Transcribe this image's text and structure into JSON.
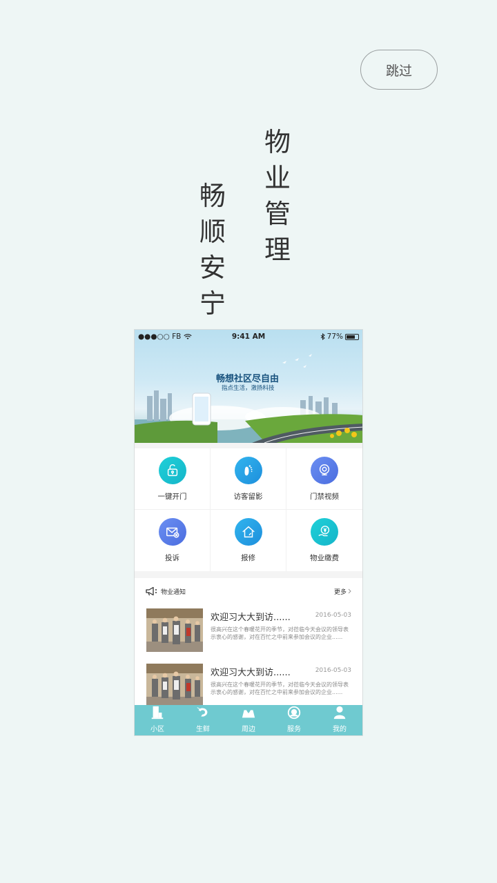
{
  "skip_button": "跳过",
  "slogan_right": [
    "物",
    "业",
    "管",
    "理"
  ],
  "slogan_left": [
    "畅",
    "顺",
    "安",
    "宁"
  ],
  "phone": {
    "status": {
      "carrier": "●●●○○ FB",
      "time": "9:41 AM",
      "battery": "77%",
      "battery_level": 0.77
    },
    "banner": {
      "title": "畅想社区尽自由",
      "subtitle": "指点生活，激扬科技"
    },
    "grid": [
      {
        "label": "一键开门",
        "icon": "unlock-icon",
        "color": "cyan"
      },
      {
        "label": "访客留影",
        "icon": "footprint-icon",
        "color": "azure"
      },
      {
        "label": "门禁视频",
        "icon": "webcam-icon",
        "color": "blue"
      },
      {
        "label": "投诉",
        "icon": "mail-icon",
        "color": "blue"
      },
      {
        "label": "报修",
        "icon": "home-repair-icon",
        "color": "azure"
      },
      {
        "label": "物业缴费",
        "icon": "yuan-hand-icon",
        "color": "cyan"
      }
    ],
    "notice": {
      "title": "物业通知",
      "more": "更多"
    },
    "news": [
      {
        "title": "欢迎习大大到访......",
        "date": "2016-05-03",
        "body": "很高兴在这个春暖花开的季节，对莅临今天会议的领导表示衷心的感谢，对在百忙之中前来参加会议的企业......"
      },
      {
        "title": "欢迎习大大到访......",
        "date": "2016-05-03",
        "body": "很高兴在这个春暖花开的季节，对莅临今天会议的领导表示衷心的感谢，对在百忙之中前来参加会议的企业......"
      }
    ],
    "tabs": [
      {
        "label": "小区",
        "icon": "building-icon"
      },
      {
        "label": "生鲜",
        "icon": "shrimp-icon"
      },
      {
        "label": "周边",
        "icon": "map-pin-icon"
      },
      {
        "label": "服务",
        "icon": "service-icon"
      },
      {
        "label": "我的",
        "icon": "user-icon"
      }
    ]
  }
}
